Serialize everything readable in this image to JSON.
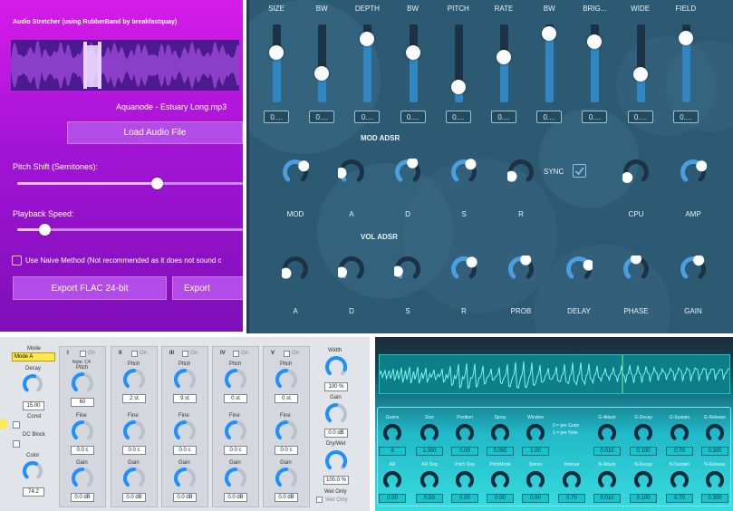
{
  "panel_a": {
    "title": "Audio Stretcher (using RubberBand by breakfastquay)",
    "file_name": "Aquanode - Estuary Long.mp3",
    "load_button": "Load Audio File",
    "pitch_label": "Pitch Shift (Semitones):",
    "pitch_level": 0.62,
    "speed_label": "Playback Speed:",
    "speed_level": 0.12,
    "naive_label": "Use Naive Method (Not recommended as it does not sound c",
    "export_flac": "Export FLAC 24-bit",
    "export_other": "Export",
    "colors": {
      "bg_top": "#d61ce8",
      "bg_bottom": "#7e0fb8"
    }
  },
  "panel_b": {
    "sliders": [
      {
        "label": "SIZE",
        "value": "0....",
        "level": 0.64
      },
      {
        "label": "BW",
        "value": "0....",
        "level": 0.37
      },
      {
        "label": "DEPTH",
        "value": "0....",
        "level": 0.81
      },
      {
        "label": "BW",
        "value": "0....",
        "level": 0.64
      },
      {
        "label": "PITCH",
        "value": "0....",
        "level": 0.2
      },
      {
        "label": "RATE",
        "value": "0....",
        "level": 0.58
      },
      {
        "label": "BW",
        "value": "0....",
        "level": 0.88
      },
      {
        "label": "BRIG...",
        "value": "0....",
        "level": 0.78
      },
      {
        "label": "WIDE",
        "value": "0....",
        "level": 0.36
      },
      {
        "label": "FIELD",
        "value": "0....",
        "level": 0.83
      }
    ],
    "mod_title": "MOD ADSR",
    "mod_knobs": [
      {
        "label": "MOD",
        "level": 0.7
      },
      {
        "label": "A",
        "level": 0.15
      },
      {
        "label": "D",
        "level": 0.6
      },
      {
        "label": "S",
        "level": 0.65
      },
      {
        "label": "R",
        "level": 0.08
      }
    ],
    "sync_label": "SYNC",
    "extra_knobs": [
      {
        "label": "CPU",
        "level": 0.05
      },
      {
        "label": "AMP",
        "level": 0.7
      }
    ],
    "vol_title": "VOL ADSR",
    "vol_knobs": [
      {
        "label": "A",
        "level": 0.08
      },
      {
        "label": "D",
        "level": 0.1
      },
      {
        "label": "S",
        "level": 0.12
      },
      {
        "label": "R",
        "level": 0.68
      },
      {
        "label": "PROB",
        "level": 0.6
      },
      {
        "label": "DELAY",
        "level": 0.75
      },
      {
        "label": "PHASE",
        "level": 0.5
      },
      {
        "label": "GAIN",
        "level": 0.62
      }
    ],
    "colors": {
      "bg": "#2d5a73",
      "accent": "#4a9fe0"
    }
  },
  "panel_c": {
    "mode_label": "Mode",
    "mode_value": "Mode A",
    "decay_label": "Decay",
    "decay_value": "15.00",
    "const_label": "Const",
    "dc_label": "DC Block",
    "color_label": "Color",
    "color_value": "74.2",
    "columns": [
      {
        "roman": "I",
        "on": "On",
        "note": "Note: C4",
        "pitch_value": "60",
        "fine_value": "0.0 c",
        "gain_value": "0.0 dB"
      },
      {
        "roman": "II",
        "on": "On",
        "note": "",
        "pitch_value": "2 st",
        "fine_value": "0.0 c",
        "gain_value": "0.0 dB"
      },
      {
        "roman": "III",
        "on": "On",
        "note": "",
        "pitch_value": "9 st",
        "fine_value": "0.0 c",
        "gain_value": "0.0 dB"
      },
      {
        "roman": "IV",
        "on": "On",
        "note": "",
        "pitch_value": "0 st",
        "fine_value": "0.0 c",
        "gain_value": "0.0 dB"
      },
      {
        "roman": "V",
        "on": "On",
        "note": "",
        "pitch_value": "0 st",
        "fine_value": "0.0 c",
        "gain_value": "0.0 dB"
      }
    ],
    "pitch_label": "Pitch",
    "fine_label": "Fine",
    "gain_label": "Gain",
    "width_label": "Width",
    "width_value": "100 %",
    "gain_value": "0.0 dB",
    "drywet_label": "Dry/Wet",
    "drywet_value": "100.0 %",
    "wetonly_label": "Wet Only",
    "wetonly_check": "Wet Only",
    "colors": {
      "bg": "#e1e4e9",
      "knob": "#1e90ff",
      "mode_bg": "#ffe94d"
    }
  },
  "panel_d": {
    "row1": [
      {
        "label": "Grains",
        "value": "8"
      },
      {
        "label": "Size",
        "value": "1.000"
      },
      {
        "label": "Position",
        "value": "0.00"
      },
      {
        "label": "Spray",
        "value": "0.050"
      },
      {
        "label": "Window",
        "value": "1.00"
      }
    ],
    "mode_note_1": "0 = per Grain",
    "mode_note_2": "1 = per Note",
    "row1_right": [
      {
        "label": "G-Attack",
        "value": "0.010"
      },
      {
        "label": "G-Decay",
        "value": "0.100"
      },
      {
        "label": "G-Sustain",
        "value": "0.70"
      },
      {
        "label": "G-Release",
        "value": "0.300"
      }
    ],
    "row2": [
      {
        "label": "AR",
        "value": "0.00"
      },
      {
        "label": "AR Dep",
        "value": "0.50"
      },
      {
        "label": "Pitch Dep",
        "value": "0.00"
      },
      {
        "label": "PitchMode",
        "value": "0.00"
      },
      {
        "label": "Stereo",
        "value": "0.00"
      },
      {
        "label": "Interval",
        "value": "0.70"
      },
      {
        "label": "N-Attack",
        "value": "0.010"
      },
      {
        "label": "N-Decay",
        "value": "0.100"
      },
      {
        "label": "N-Sustain",
        "value": "0.70"
      },
      {
        "label": "N-Release",
        "value": "0.300"
      }
    ],
    "colors": {
      "wave": "#7af7f0",
      "bg": "#21b8c7"
    }
  }
}
